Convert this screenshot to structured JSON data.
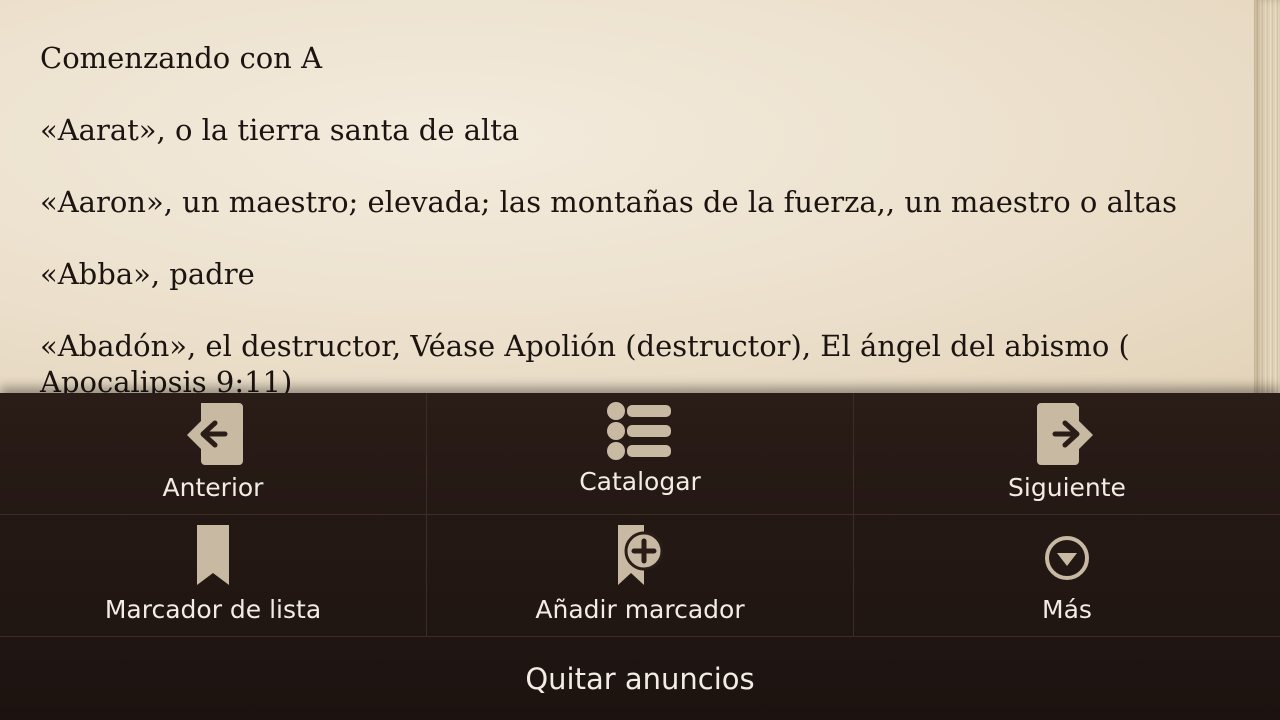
{
  "reader": {
    "heading": "Comenzando con A",
    "entries": [
      "«Aarat», o la tierra santa de alta",
      "«Aaron», un maestro; elevada; las montañas de la fuerza,, un maestro o altas",
      "«Abba», padre",
      "«Abadón», el destructor, Véase Apolión (destructor), El ángel del abismo ( Apocalipsis 9:11)"
    ]
  },
  "menu": {
    "row1": [
      {
        "label": "Anterior",
        "icon": "page-back-icon"
      },
      {
        "label": "Catalogar",
        "icon": "list-icon"
      },
      {
        "label": "Siguiente",
        "icon": "page-forward-icon"
      }
    ],
    "row2": [
      {
        "label": "Marcador de lista",
        "icon": "bookmark-icon"
      },
      {
        "label": "Añadir marcador",
        "icon": "add-bookmark-icon"
      },
      {
        "label": "Más",
        "icon": "more-icon"
      }
    ],
    "remove_ads": "Quitar anuncios"
  },
  "colors": {
    "icon": "#c8b9a3",
    "menu_bg": "#231814",
    "paper": "#ece0cc"
  }
}
